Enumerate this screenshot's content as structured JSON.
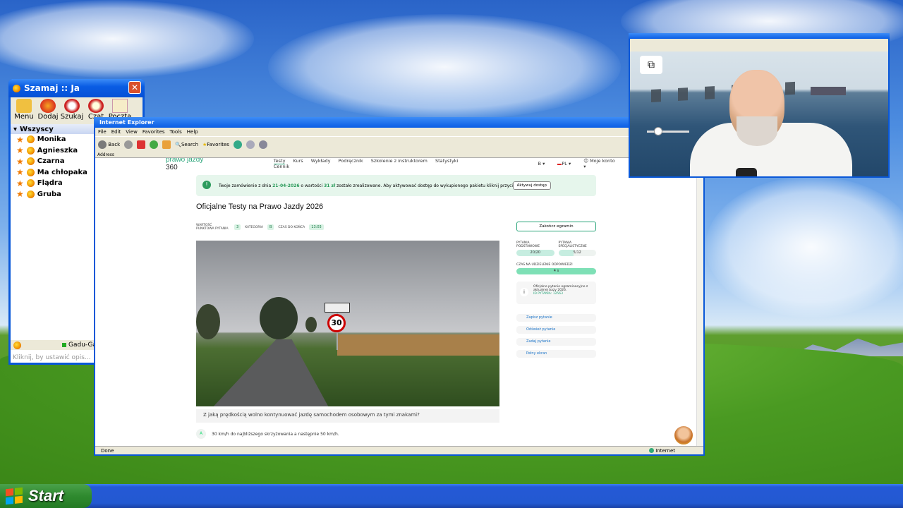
{
  "taskbar": {
    "start_label": "Start"
  },
  "gadu": {
    "title": "Szamaj :: Ja",
    "tools": [
      "Menu",
      "Dodaj",
      "Szukaj",
      "Czat",
      "Poczta"
    ],
    "group": "Wszyscy",
    "contacts": [
      "Monika",
      "Agnieszka",
      "Czarna",
      "Ma chłopaka",
      "Flądra",
      "Gruba"
    ],
    "status_label": "Gadu-Gadu",
    "description_placeholder": "Kliknij, by ustawić opis..."
  },
  "ie": {
    "title": "Internet Explorer",
    "menu": [
      "File",
      "Edit",
      "View",
      "Favorites",
      "Tools",
      "Help"
    ],
    "toolbar": {
      "back": "Back",
      "search": "Search",
      "favorites": "Favorites"
    },
    "address_label": "Address",
    "status_done": "Done",
    "status_zone": "Internet"
  },
  "site": {
    "logo_text": "prawo jazdy",
    "logo_num": "360",
    "nav": [
      "Testy",
      "Kurs",
      "Wykłady",
      "Podręcznik",
      "Szkolenie z instruktorem",
      "Statystyki",
      "Cennik"
    ],
    "category": "B",
    "lang": "PL",
    "account": "Moje konto",
    "banner": {
      "text_start": "Twoje zamówienie z dnia ",
      "date": "21-04-2026",
      "text_mid": " o wartości ",
      "amount": "31 zł",
      "text_end": " zostało zrealizowane. Aby aktywować dostęp do wykupionego pakietu kliknij przycisk.",
      "button": "Aktywuj dostęp"
    },
    "heading": "Oficjalne Testy na Prawo Jazdy 2026",
    "meta": {
      "points_label": "WARTOŚĆ PUNKTOWA PYTANIA",
      "points": "3",
      "cat_label": "KATEGORIA",
      "cat": "B",
      "time_label": "CZAS DO KOŃCA",
      "time": "13:03"
    },
    "end_button": "Zakończ egzamin",
    "sign_value": "30",
    "question": "Z jaką prędkością wolno kontynuować jazdę samochodem osobowym za tymi znakami?",
    "answer": {
      "letter": "A",
      "text": "30 km/h do najbliższego skrzyżowania a następnie 50 km/h."
    },
    "side": {
      "basic_label": "PYTANIA PODSTAWOWE",
      "basic": "20/20",
      "special_label": "PYTANIA SPECJALISTYCZNE",
      "special": "5/12",
      "time_label": "CZAS NA UDZIELENIE ODPOWIEDZI",
      "time": "4 s",
      "info_text": "Oficjalne pytanie egzaminacyjne z aktualnej bazy 2026.",
      "info_id": "ID PYTANIA: 12563",
      "actions": [
        "Zapisz pytanie",
        "Odśwież pytanie",
        "Zadaj pytanie",
        "Pełny ekran"
      ]
    }
  },
  "colors": {
    "accent": "#2aa57a",
    "xp_blue": "#0a58d8"
  }
}
